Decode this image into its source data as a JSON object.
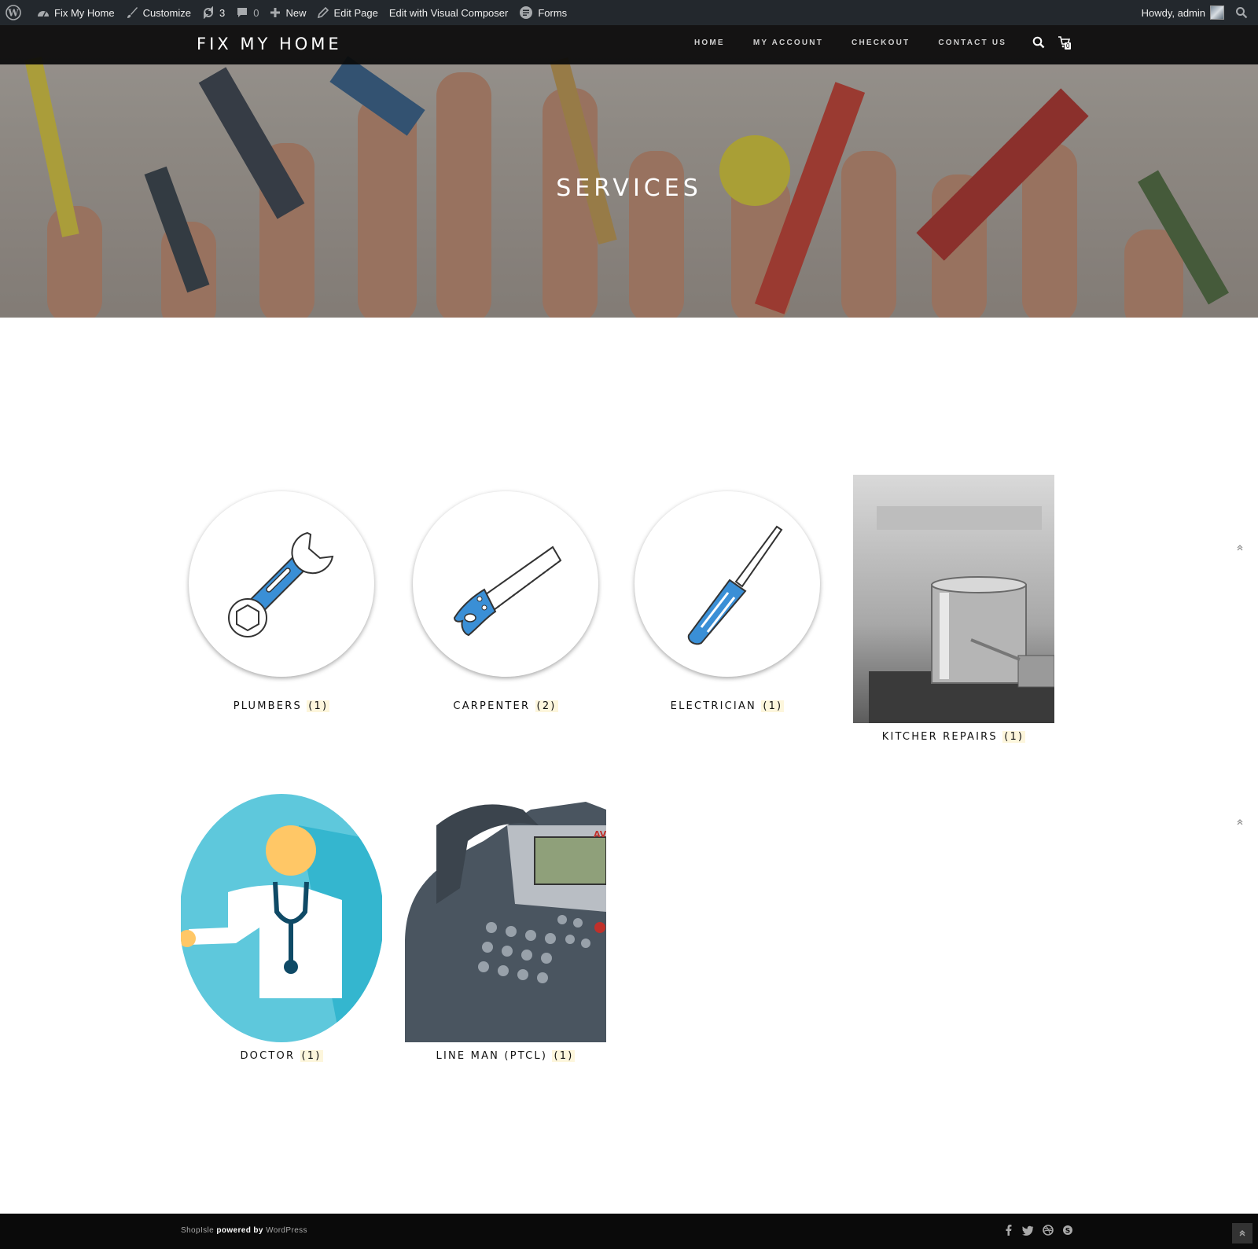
{
  "adminbar": {
    "site_name": "Fix My Home",
    "customize": "Customize",
    "updates": "3",
    "comments": "0",
    "new": "New",
    "edit_page": "Edit Page",
    "visual_composer": "Edit with Visual Composer",
    "forms": "Forms",
    "howdy": "Howdy, admin"
  },
  "header": {
    "logo": "FIX MY HOME",
    "nav": [
      "HOME",
      "MY ACCOUNT",
      "CHECKOUT",
      "CONTACT US"
    ],
    "cart_count": "0"
  },
  "hero": {
    "title": "SERVICES"
  },
  "categories": [
    {
      "name": "PLUMBERS",
      "count": "(1)",
      "icon": "wrench-icon"
    },
    {
      "name": "CARPENTER",
      "count": "(2)",
      "icon": "saw-icon"
    },
    {
      "name": "ELECTRICIAN",
      "count": "(1)",
      "icon": "screwdriver-icon"
    },
    {
      "name": "KITCHER REPAIRS",
      "count": "(1)",
      "icon": "cooking-pot-photo"
    },
    {
      "name": "DOCTOR",
      "count": "(1)",
      "icon": "doctor-icon"
    },
    {
      "name": "LINE MAN (PTCL)",
      "count": "(1)",
      "icon": "desk-phone-photo"
    }
  ],
  "footer": {
    "theme": "ShopIsle",
    "powered": "powered by",
    "platform": "WordPress"
  },
  "colors": {
    "adminbar_bg": "#23282d",
    "header_bg": "#0a0a0a",
    "accent_blue": "#3a8fd6",
    "count_bg": "#fdf6dc",
    "doctor_bg": "#5ec8dc"
  }
}
